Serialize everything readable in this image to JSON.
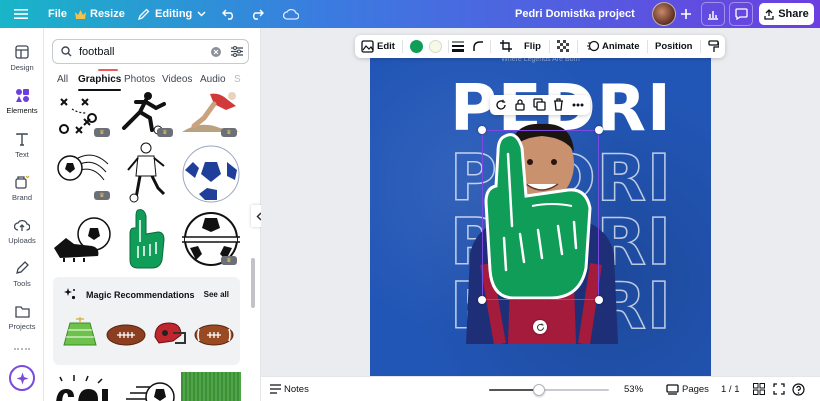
{
  "topbar": {
    "file_label": "File",
    "resize_label": "Resize",
    "editing_label": "Editing",
    "project_title": "Pedri Domistka project",
    "share_label": "Share"
  },
  "rail": {
    "items": [
      {
        "label": "Design",
        "icon": "layout-icon"
      },
      {
        "label": "Elements",
        "icon": "shapes-icon"
      },
      {
        "label": "Text",
        "icon": "text-icon"
      },
      {
        "label": "Brand",
        "icon": "brand-icon"
      },
      {
        "label": "Uploads",
        "icon": "cloud-upload-icon"
      },
      {
        "label": "Tools",
        "icon": "pen-tool-icon"
      },
      {
        "label": "Projects",
        "icon": "folder-icon"
      }
    ],
    "active": "Elements"
  },
  "panel": {
    "search_value": "football",
    "tabs": [
      "All",
      "Graphics",
      "Photos",
      "Videos",
      "Audio"
    ],
    "active_tab": "Graphics",
    "magic_title": "Magic Recommendations",
    "see_all_label": "See all"
  },
  "toolbar": {
    "edit_label": "Edit",
    "flip_label": "Flip",
    "animate_label": "Animate",
    "position_label": "Position",
    "colors": [
      "#0f9d58",
      "#f6f9e6"
    ]
  },
  "poster": {
    "tagline": "Where Legends Are Born",
    "repeated_text": "PEDRI"
  },
  "bottombar": {
    "notes_label": "Notes",
    "zoom_label": "53%",
    "zoom_value": 0.42,
    "pages_label": "Pages",
    "page_count": "1 / 1"
  },
  "colors": {
    "accent": "#7a4bde",
    "poster_blue": "#2256b6",
    "foam_green": "#0f9d58"
  }
}
